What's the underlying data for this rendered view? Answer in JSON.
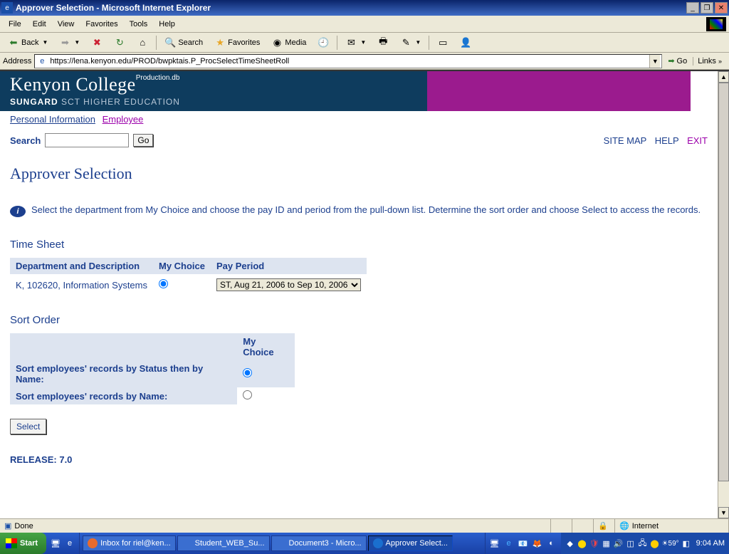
{
  "window": {
    "title": "Approver Selection - Microsoft Internet Explorer"
  },
  "menu": {
    "file": "File",
    "edit": "Edit",
    "view": "View",
    "favorites": "Favorites",
    "tools": "Tools",
    "help": "Help"
  },
  "toolbar": {
    "back": "Back",
    "search": "Search",
    "favorites": "Favorites",
    "media": "Media"
  },
  "address": {
    "label": "Address",
    "url": "https://lena.kenyon.edu/PROD/bwpktais.P_ProcSelectTimeSheetRoll",
    "go": "Go",
    "links": "Links"
  },
  "banner": {
    "college": "Kenyon College",
    "prod": "Production.db",
    "sungard": "SUNGARD",
    "sct": " SCT HIGHER EDUCATION"
  },
  "topnav": {
    "personal": "Personal Information",
    "employee": "Employee"
  },
  "search": {
    "label": "Search",
    "go": "Go"
  },
  "rightlinks": {
    "sitemap": "SITE MAP",
    "help": "HELP",
    "exit": "EXIT"
  },
  "page": {
    "title": "Approver Selection",
    "info": "Select the department from My Choice and choose the pay ID and period from the pull-down list. Determine the sort order and choose Select to access the records.",
    "timesheet": "Time Sheet",
    "sortorder": "Sort Order",
    "select": "Select",
    "release": "RELEASE: 7.0"
  },
  "ts": {
    "h1": "Department and Description",
    "h2": "My Choice",
    "h3": "Pay Period",
    "dept": "K, 102620, Information Systems",
    "period": "ST, Aug 21, 2006 to Sep 10, 2006"
  },
  "so": {
    "h_empty": "",
    "h_choice": "My Choice",
    "r1": "Sort employees' records by Status then by Name:",
    "r2": "Sort employees' records by Name:"
  },
  "status": {
    "done": "Done",
    "zone": "Internet"
  },
  "taskbar": {
    "start": "Start",
    "task1": "Inbox for riel@ken...",
    "task2": "Student_WEB_Su...",
    "task3": "Document3 - Micro...",
    "task4": "Approver Select...",
    "temp": "59°",
    "clock": "9:04 AM"
  }
}
